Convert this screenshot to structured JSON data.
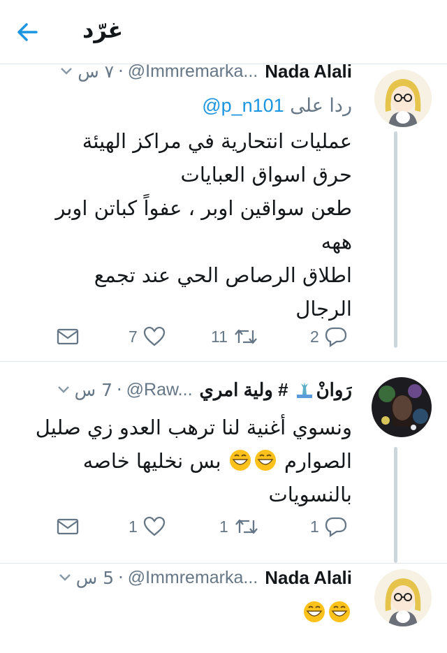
{
  "header": {
    "title": "غرّد"
  },
  "tweets": [
    {
      "name": "Nada Alali",
      "handle": "@Immremarka...",
      "time": "٧ س",
      "reply_prefix": "ردا على",
      "reply_to": "@p_n101",
      "lines": [
        "عمليات انتحارية في مراكز الهيئة",
        "حرق اسواق العبايات",
        "طعن سواقين اوبر ، عفواً كباتن اوبر",
        "ههه",
        "اطلاق الرصاص الحي عند تجمع",
        "الرجال"
      ],
      "reply_count": "2",
      "retweet_count": "11",
      "like_count": "7"
    },
    {
      "name": "رَوانْ",
      "name_suffix": "# ولية امري",
      "handle": "@Raw...",
      "time": "7 س",
      "lines": [
        "ونسوي أغنية لنا ترهب العدو زي صليل",
        "الصوارم",
        "بس نخليها خاصه",
        "بالنسويات"
      ],
      "reply_count": "1",
      "retweet_count": "1",
      "like_count": "1"
    },
    {
      "name": "Nada Alali",
      "handle": "@Immremarka...",
      "time": "5 س"
    }
  ],
  "colors": {
    "accent": "#1b95e0",
    "muted": "#657786",
    "divider": "#e1e8ed",
    "thread": "#ccd6dd"
  }
}
